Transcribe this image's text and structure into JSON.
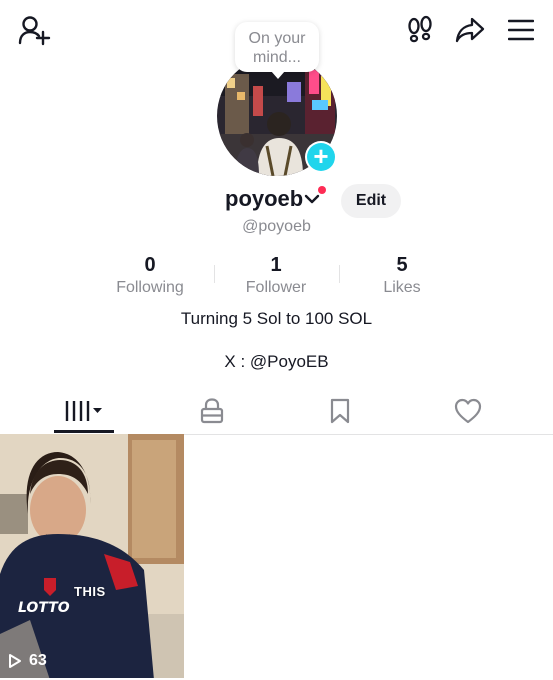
{
  "header": {
    "add_friend_icon": "add-user-icon",
    "footprints_icon": "footprints-icon",
    "share_icon": "share-icon",
    "menu_icon": "menu-icon"
  },
  "bubble": {
    "line1": "On your",
    "line2": "mind..."
  },
  "profile": {
    "username": "poyoeb",
    "handle": "@poyoeb",
    "edit_label": "Edit",
    "notification_color": "#fe2c55",
    "add_button_color": "#20d5ec"
  },
  "stats": [
    {
      "value": "0",
      "label": "Following"
    },
    {
      "value": "1",
      "label": "Follower"
    },
    {
      "value": "5",
      "label": "Likes"
    }
  ],
  "bio": {
    "line1": "Turning 5 Sol to 100 SOL",
    "line2": "X : @PoyoEB"
  },
  "tabs": [
    {
      "icon": "videos-grid-icon",
      "selected": true
    },
    {
      "icon": "lock-icon",
      "selected": false
    },
    {
      "icon": "bookmark-icon",
      "selected": false
    },
    {
      "icon": "heart-icon",
      "selected": false
    }
  ],
  "videos": [
    {
      "caption": "THIS",
      "views": "63"
    }
  ]
}
